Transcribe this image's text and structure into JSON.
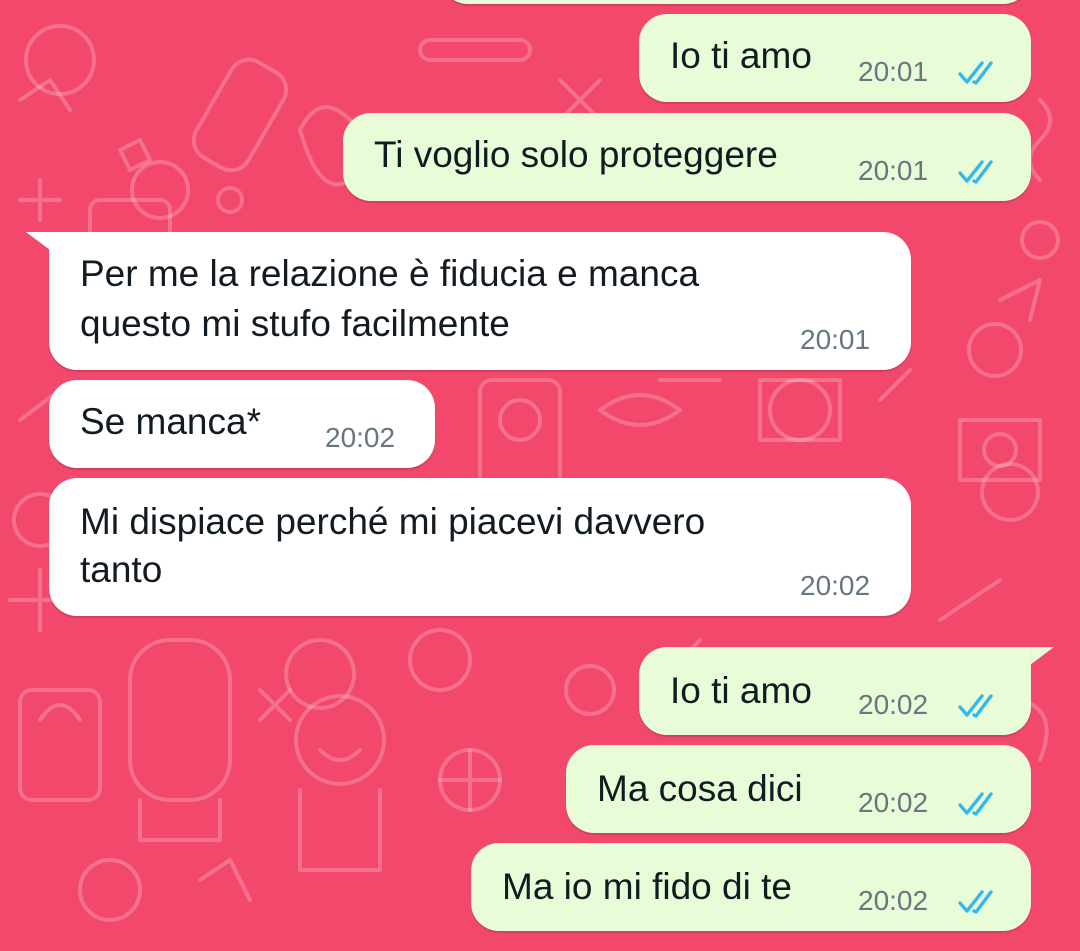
{
  "theme": {
    "wallpaper_color": "#f2486b",
    "outgoing_bubble_color": "#e7fcd7",
    "incoming_bubble_color": "#ffffff",
    "read_tick_color": "#34b7f1",
    "time_color": "#667781"
  },
  "messages": [
    {
      "direction": "outgoing",
      "lines": [
        "Io ti amo"
      ],
      "time": "20:01",
      "status": "read"
    },
    {
      "direction": "outgoing",
      "lines": [
        "Ti voglio solo proteggere"
      ],
      "time": "20:01",
      "status": "read"
    },
    {
      "direction": "incoming",
      "lines": [
        "Per me la relazione è fiducia e manca",
        "questo mi stufo facilmente"
      ],
      "time": "20:01"
    },
    {
      "direction": "incoming",
      "lines": [
        "Se manca*"
      ],
      "time": "20:02"
    },
    {
      "direction": "incoming",
      "lines": [
        "Mi dispiace perché mi piacevi davvero",
        "tanto"
      ],
      "time": "20:02"
    },
    {
      "direction": "outgoing",
      "lines": [
        "Io ti amo"
      ],
      "time": "20:02",
      "status": "read"
    },
    {
      "direction": "outgoing",
      "lines": [
        "Ma cosa dici"
      ],
      "time": "20:02",
      "status": "read"
    },
    {
      "direction": "outgoing",
      "lines": [
        "Ma io mi fido di te"
      ],
      "time": "20:02",
      "status": "read"
    }
  ]
}
